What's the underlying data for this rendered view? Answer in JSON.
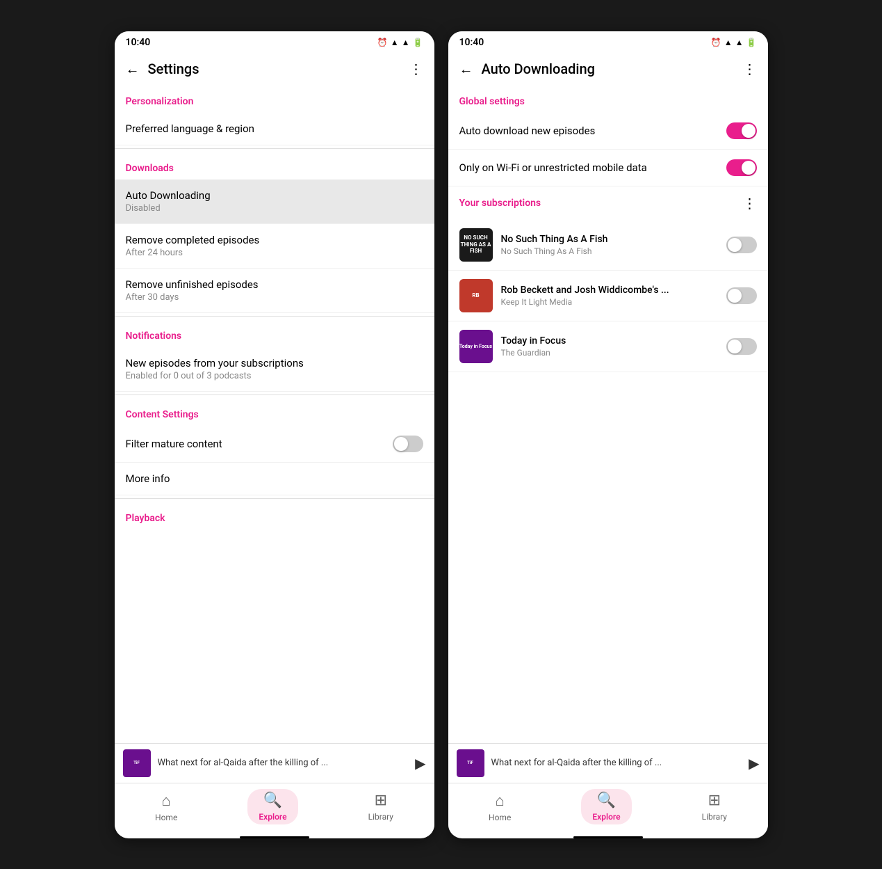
{
  "screen1": {
    "statusBar": {
      "time": "10:40"
    },
    "topBar": {
      "title": "Settings",
      "backLabel": "←",
      "moreLabel": "⋮"
    },
    "sections": [
      {
        "header": "Personalization",
        "items": [
          {
            "title": "Preferred language & region",
            "subtitle": ""
          }
        ]
      },
      {
        "header": "Downloads",
        "items": [
          {
            "title": "Auto Downloading",
            "subtitle": "Disabled",
            "highlighted": true
          },
          {
            "title": "Remove completed episodes",
            "subtitle": "After 24 hours"
          },
          {
            "title": "Remove unfinished episodes",
            "subtitle": "After 30 days"
          }
        ]
      },
      {
        "header": "Notifications",
        "items": [
          {
            "title": "New episodes from your subscriptions",
            "subtitle": "Enabled for 0 out of 3 podcasts"
          }
        ]
      },
      {
        "header": "Content Settings",
        "items": [
          {
            "title": "Filter mature content",
            "hasToggle": true,
            "toggleOn": false
          },
          {
            "title": "More info",
            "subtitle": ""
          }
        ]
      },
      {
        "header": "Playback",
        "items": []
      }
    ],
    "playerBar": {
      "title": "What next for al-Qaida after the killing of ..."
    },
    "bottomNav": {
      "items": [
        {
          "label": "Home",
          "icon": "⌂",
          "active": false
        },
        {
          "label": "Explore",
          "icon": "⌕",
          "active": true
        },
        {
          "label": "Library",
          "icon": "▦",
          "active": false
        }
      ]
    }
  },
  "screen2": {
    "statusBar": {
      "time": "10:40"
    },
    "topBar": {
      "title": "Auto Downloading",
      "backLabel": "←",
      "moreLabel": "⋮"
    },
    "globalSettings": {
      "label": "Global settings",
      "items": [
        {
          "title": "Auto download new episodes",
          "toggleOn": true
        },
        {
          "title": "Only on Wi-Fi or unrestricted mobile data",
          "toggleOn": true
        }
      ]
    },
    "subscriptions": {
      "label": "Your subscriptions",
      "podcasts": [
        {
          "name": "No Such Thing As A Fish",
          "author": "No Such Thing As A Fish",
          "toggleOn": false,
          "artworkType": "fish"
        },
        {
          "name": "Rob Beckett and Josh Widdicombe's ...",
          "author": "Keep It Light Media",
          "toggleOn": false,
          "artworkType": "rob"
        },
        {
          "name": "Today in Focus",
          "author": "The Guardian",
          "toggleOn": false,
          "artworkType": "focus"
        }
      ]
    },
    "playerBar": {
      "title": "What next for al-Qaida after the killing of ..."
    },
    "bottomNav": {
      "items": [
        {
          "label": "Home",
          "icon": "⌂",
          "active": false
        },
        {
          "label": "Explore",
          "icon": "⌕",
          "active": true
        },
        {
          "label": "Library",
          "icon": "▦",
          "active": false
        }
      ]
    }
  }
}
